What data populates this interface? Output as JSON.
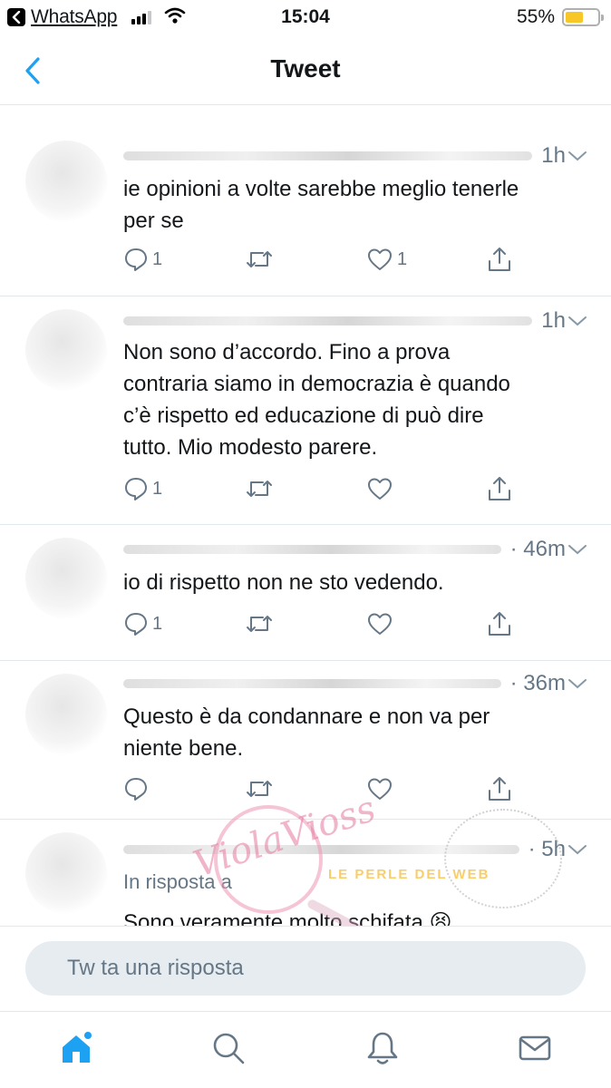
{
  "status_bar": {
    "back_app": "WhatsApp",
    "time": "15:04",
    "battery": "55%",
    "battery_level": 0.55
  },
  "nav": {
    "title": "Tweet"
  },
  "tweets": [
    {
      "time": "1h",
      "text_lines": [
        "ie opinioni a volte sarebbe meglio tenerle",
        "per se"
      ],
      "reply_count": "1",
      "like_count": "1"
    },
    {
      "time": "1h",
      "text_lines": [
        "Non sono d’accordo. Fino a prova",
        "contraria siamo in democrazia è quando",
        "c’è rispetto ed educazione di può dire",
        "tutto. Mio modesto parere."
      ],
      "reply_count": "1",
      "like_count": ""
    },
    {
      "time": "· 46m",
      "text_lines": [
        "io di rispetto non ne sto vedendo."
      ],
      "reply_count": "1",
      "like_count": ""
    },
    {
      "time": "· 36m",
      "text_lines": [
        "Questo è da condannare e non va per",
        "niente bene."
      ],
      "reply_count": "",
      "like_count": ""
    },
    {
      "time": "· 5h",
      "reply_to": "In risposta a",
      "text_lines": [
        "Sono veramente molto schifata 😫"
      ]
    }
  ],
  "compose": {
    "placeholder": "Tw   ta una risposta"
  },
  "tabs": [
    "home-icon",
    "search-icon",
    "notifications-icon",
    "messages-icon"
  ],
  "colors": {
    "accent": "#1da1f2",
    "secondary_text": "#657786",
    "divider": "#e1e8ed",
    "battery": "#f7c728"
  }
}
